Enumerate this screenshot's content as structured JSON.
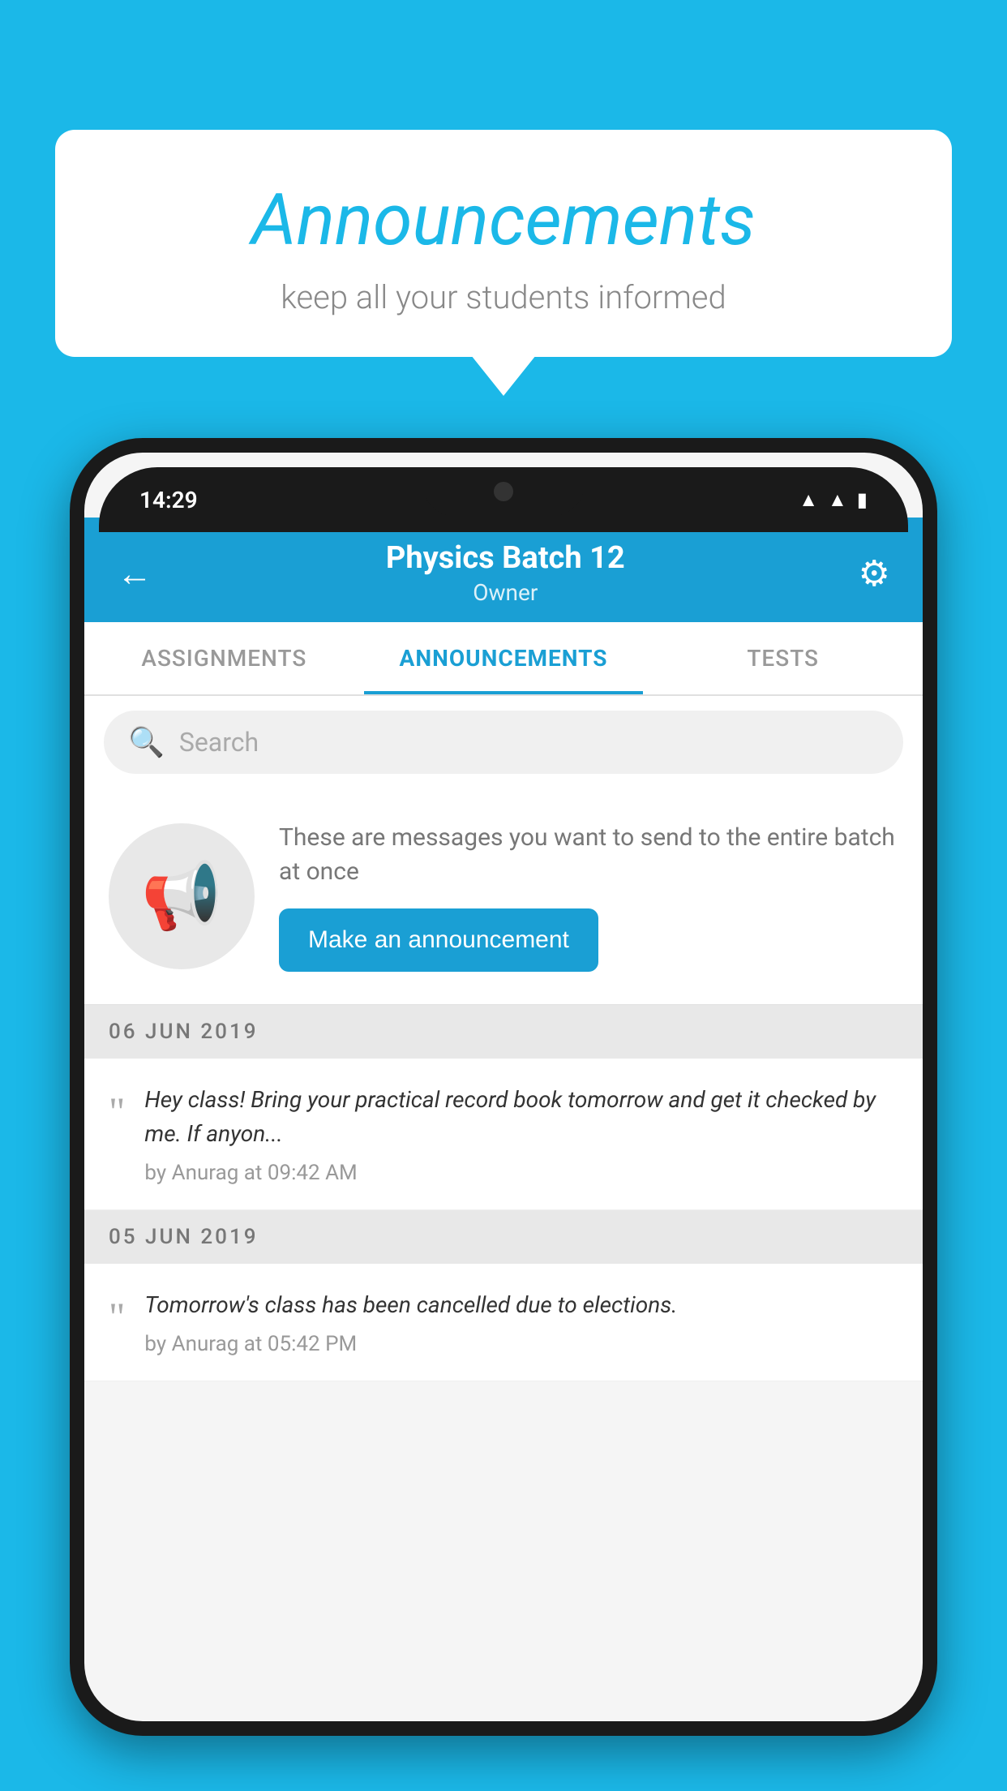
{
  "background_color": "#1BB8E8",
  "speech_bubble": {
    "title": "Announcements",
    "subtitle": "keep all your students informed"
  },
  "app": {
    "header": {
      "batch_name": "Physics Batch 12",
      "role": "Owner",
      "back_label": "←",
      "gear_label": "⚙"
    },
    "status_bar": {
      "time": "14:29"
    },
    "tabs": [
      {
        "label": "ASSIGNMENTS",
        "active": false
      },
      {
        "label": "ANNOUNCEMENTS",
        "active": true
      },
      {
        "label": "TESTS",
        "active": false
      }
    ],
    "search": {
      "placeholder": "Search"
    },
    "promo": {
      "description": "These are messages you want to send to the entire batch at once",
      "button_label": "Make an announcement"
    },
    "announcements": [
      {
        "date": "06  JUN  2019",
        "message": "Hey class! Bring your practical record book tomorrow and get it checked by me. If anyon...",
        "meta": "by Anurag at 09:42 AM"
      },
      {
        "date": "05  JUN  2019",
        "message": "Tomorrow's class has been cancelled due to elections.",
        "meta": "by Anurag at 05:42 PM"
      }
    ]
  }
}
